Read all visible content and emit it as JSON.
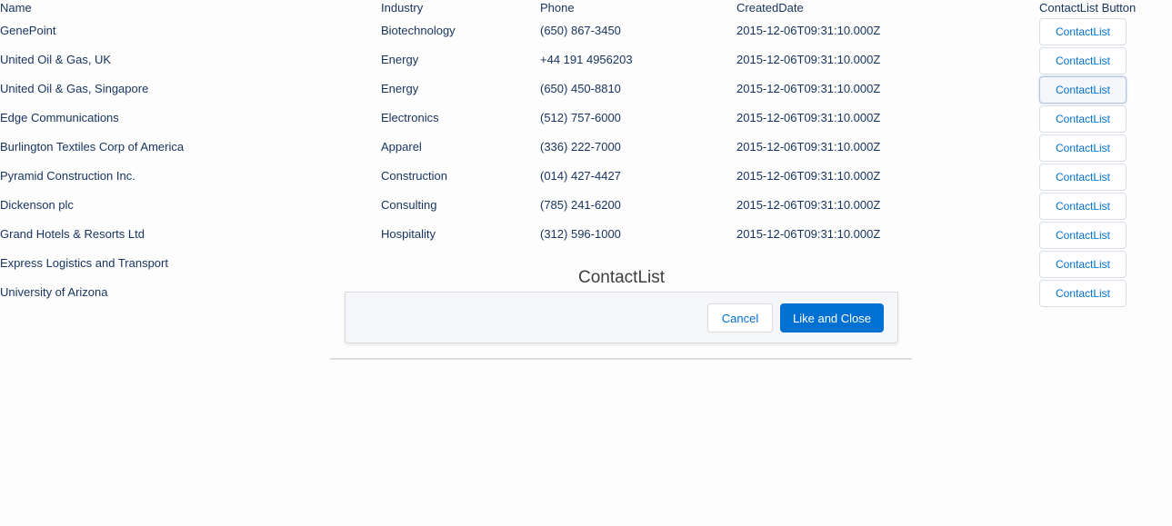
{
  "table": {
    "headers": {
      "name": "Name",
      "industry": "Industry",
      "phone": "Phone",
      "created_date": "CreatedDate",
      "button": "ContactList Button"
    },
    "rows": [
      {
        "name": "GenePoint",
        "industry": "Biotechnology",
        "phone": "(650) 867-3450",
        "created_date": "2015-12-06T09:31:10.000Z",
        "button_label": "ContactList"
      },
      {
        "name": "United Oil & Gas, UK",
        "industry": "Energy",
        "phone": "+44 191 4956203",
        "created_date": "2015-12-06T09:31:10.000Z",
        "button_label": "ContactList"
      },
      {
        "name": "United Oil & Gas, Singapore",
        "industry": "Energy",
        "phone": "(650) 450-8810",
        "created_date": "2015-12-06T09:31:10.000Z",
        "button_label": "ContactList"
      },
      {
        "name": "Edge Communications",
        "industry": "Electronics",
        "phone": "(512) 757-6000",
        "created_date": "2015-12-06T09:31:10.000Z",
        "button_label": "ContactList"
      },
      {
        "name": "Burlington Textiles Corp of America",
        "industry": "Apparel",
        "phone": "(336) 222-7000",
        "created_date": "2015-12-06T09:31:10.000Z",
        "button_label": "ContactList"
      },
      {
        "name": "Pyramid Construction Inc.",
        "industry": "Construction",
        "phone": "(014) 427-4427",
        "created_date": "2015-12-06T09:31:10.000Z",
        "button_label": "ContactList"
      },
      {
        "name": "Dickenson plc",
        "industry": "Consulting",
        "phone": "(785) 241-6200",
        "created_date": "2015-12-06T09:31:10.000Z",
        "button_label": "ContactList"
      },
      {
        "name": "Grand Hotels & Resorts Ltd",
        "industry": "Hospitality",
        "phone": "(312) 596-1000",
        "created_date": "2015-12-06T09:31:10.000Z",
        "button_label": "ContactList"
      },
      {
        "name": "Express Logistics and Transport",
        "industry": "",
        "phone": "",
        "created_date": "",
        "button_label": "ContactList"
      },
      {
        "name": "University of Arizona",
        "industry": "",
        "phone": "",
        "created_date": "",
        "button_label": "ContactList"
      }
    ]
  },
  "modal": {
    "title": "ContactList",
    "cancel_label": "Cancel",
    "confirm_label": "Like and Close"
  },
  "colors": {
    "brand": "#0070d2",
    "text": "#16325c",
    "footer_bg": "#f4f6f9"
  }
}
